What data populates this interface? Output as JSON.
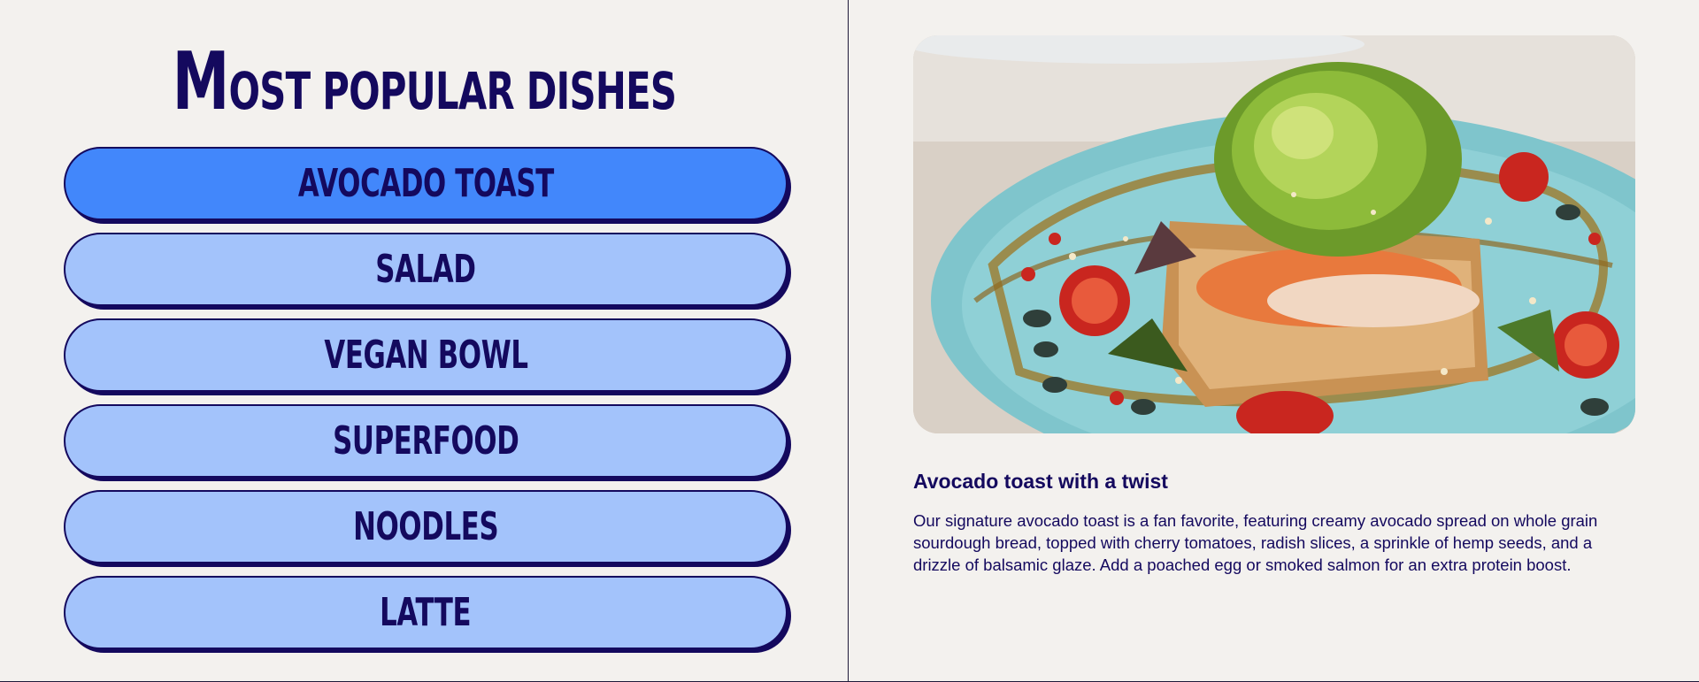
{
  "page": {
    "title_first_letter": "M",
    "title_rest": "OST POPULAR DISHES"
  },
  "dishes": [
    {
      "label": "AVOCADO TOAST",
      "active": true
    },
    {
      "label": "SALAD",
      "active": false
    },
    {
      "label": "VEGAN BOWL",
      "active": false
    },
    {
      "label": "SUPERFOOD",
      "active": false
    },
    {
      "label": "NOODLES",
      "active": false
    },
    {
      "label": "LATTE",
      "active": false
    }
  ],
  "detail": {
    "image_icon": "avocado-toast-photo",
    "title": "Avocado toast with a twist",
    "description": "Our signature avocado toast is a fan favorite, featuring creamy avocado spread on whole grain sourdough bread, topped with cherry tomatoes, radish slices, a sprinkle of hemp seeds, and a drizzle of balsamic glaze. Add a poached egg or smoked salmon for an extra protein boost."
  },
  "colors": {
    "background": "#f3f1ee",
    "ink": "#14095e",
    "button": "#a3c3fb",
    "button_active": "#4287fb"
  }
}
